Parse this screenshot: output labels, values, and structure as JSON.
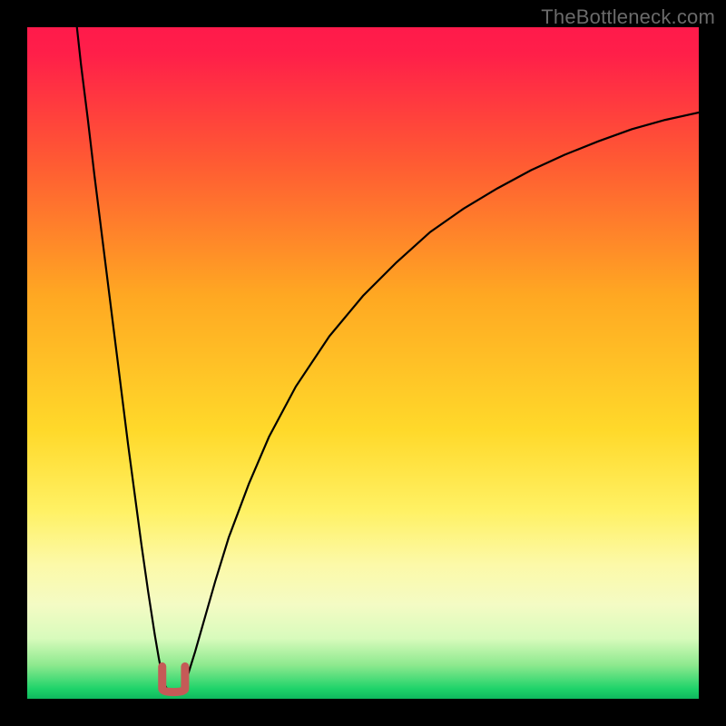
{
  "watermark": {
    "text": "TheBottleneck.com"
  },
  "chart_data": {
    "type": "line",
    "title": "",
    "xlabel": "",
    "ylabel": "",
    "xlim": [
      0,
      100
    ],
    "ylim": [
      0,
      100
    ],
    "grid": false,
    "legend": "none",
    "gradient_stops": [
      {
        "offset": 0,
        "color": "#ff1a4b"
      },
      {
        "offset": 0.04,
        "color": "#ff1f49"
      },
      {
        "offset": 0.2,
        "color": "#ff5a33"
      },
      {
        "offset": 0.4,
        "color": "#ffa822"
      },
      {
        "offset": 0.6,
        "color": "#ffd92a"
      },
      {
        "offset": 0.72,
        "color": "#fff164"
      },
      {
        "offset": 0.8,
        "color": "#fcf9a8"
      },
      {
        "offset": 0.86,
        "color": "#f4fbc4"
      },
      {
        "offset": 0.91,
        "color": "#d8fbbc"
      },
      {
        "offset": 0.95,
        "color": "#8de98e"
      },
      {
        "offset": 0.985,
        "color": "#1fd36a"
      },
      {
        "offset": 1.0,
        "color": "#0fb85e"
      }
    ],
    "series": [
      {
        "name": "bottleneck-curve",
        "stroke": "#000000",
        "stroke_width": 2.2,
        "points": [
          {
            "x": 7.4,
            "y": 100.0
          },
          {
            "x": 8.0,
            "y": 94.5
          },
          {
            "x": 9.0,
            "y": 86.5
          },
          {
            "x": 10.0,
            "y": 78.0
          },
          {
            "x": 11.0,
            "y": 70.0
          },
          {
            "x": 12.0,
            "y": 62.0
          },
          {
            "x": 13.0,
            "y": 54.0
          },
          {
            "x": 14.0,
            "y": 46.0
          },
          {
            "x": 15.0,
            "y": 38.0
          },
          {
            "x": 16.0,
            "y": 30.5
          },
          {
            "x": 17.0,
            "y": 23.0
          },
          {
            "x": 18.0,
            "y": 16.0
          },
          {
            "x": 19.0,
            "y": 9.5
          },
          {
            "x": 19.6,
            "y": 6.0
          },
          {
            "x": 20.1,
            "y": 3.4
          },
          {
            "x": 20.6,
            "y": 1.8
          },
          {
            "x": 21.2,
            "y": 1.0
          },
          {
            "x": 22.0,
            "y": 0.8
          },
          {
            "x": 22.8,
            "y": 1.2
          },
          {
            "x": 23.4,
            "y": 2.2
          },
          {
            "x": 24.0,
            "y": 3.8
          },
          {
            "x": 25.0,
            "y": 7.0
          },
          {
            "x": 26.0,
            "y": 10.5
          },
          {
            "x": 28.0,
            "y": 17.5
          },
          {
            "x": 30.0,
            "y": 24.0
          },
          {
            "x": 33.0,
            "y": 32.0
          },
          {
            "x": 36.0,
            "y": 39.0
          },
          {
            "x": 40.0,
            "y": 46.5
          },
          {
            "x": 45.0,
            "y": 54.0
          },
          {
            "x": 50.0,
            "y": 60.0
          },
          {
            "x": 55.0,
            "y": 65.0
          },
          {
            "x": 60.0,
            "y": 69.5
          },
          {
            "x": 65.0,
            "y": 73.0
          },
          {
            "x": 70.0,
            "y": 76.0
          },
          {
            "x": 75.0,
            "y": 78.7
          },
          {
            "x": 80.0,
            "y": 81.0
          },
          {
            "x": 85.0,
            "y": 83.0
          },
          {
            "x": 90.0,
            "y": 84.8
          },
          {
            "x": 95.0,
            "y": 86.2
          },
          {
            "x": 100.0,
            "y": 87.3
          }
        ]
      }
    ],
    "markers": [
      {
        "name": "optimum-marker",
        "shape": "u",
        "color": "#c55a57",
        "stroke_width": 9,
        "cx": 21.8,
        "cy": 2.5,
        "w": 3.4,
        "h": 3.0
      }
    ],
    "annotations": []
  }
}
